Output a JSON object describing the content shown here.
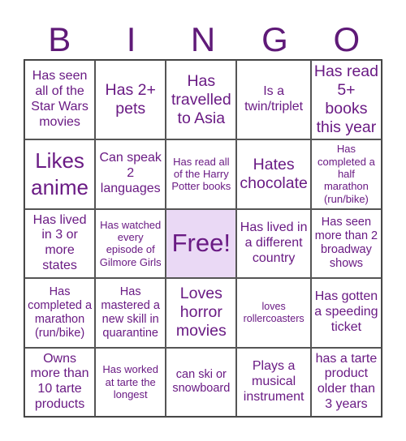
{
  "header": {
    "letters": [
      "B",
      "I",
      "N",
      "G",
      "O"
    ]
  },
  "cells": [
    "Has seen all of the Star Wars movies",
    "Has 2+ pets",
    "Has travelled to Asia",
    "Is a twin/triplet",
    "Has read 5+ books this year",
    "Likes anime",
    "Can speak 2 languages",
    "Has read all of the Harry Potter books",
    "Hates chocolate",
    "Has completed a half marathon (run/bike)",
    "Has lived in 3 or more states",
    "Has watched every episode of Gilmore Girls",
    "Free!",
    "Has lived in a different country",
    "Has seen more than 2 broadway shows",
    "Has completed a marathon (run/bike)",
    "Has mastered a new skill in quarantine",
    "Loves horror movies",
    "loves rollercoasters",
    "Has gotten a speeding ticket",
    "Owns more than 10 tarte products",
    "Has worked at tarte the longest",
    "can ski or snowboard",
    "Plays a musical instrument",
    "has a tarte product older than 3 years"
  ],
  "colors": {
    "text": "#6a1b84",
    "header": "#5f1a78",
    "free_bg": "#ead9f5"
  }
}
